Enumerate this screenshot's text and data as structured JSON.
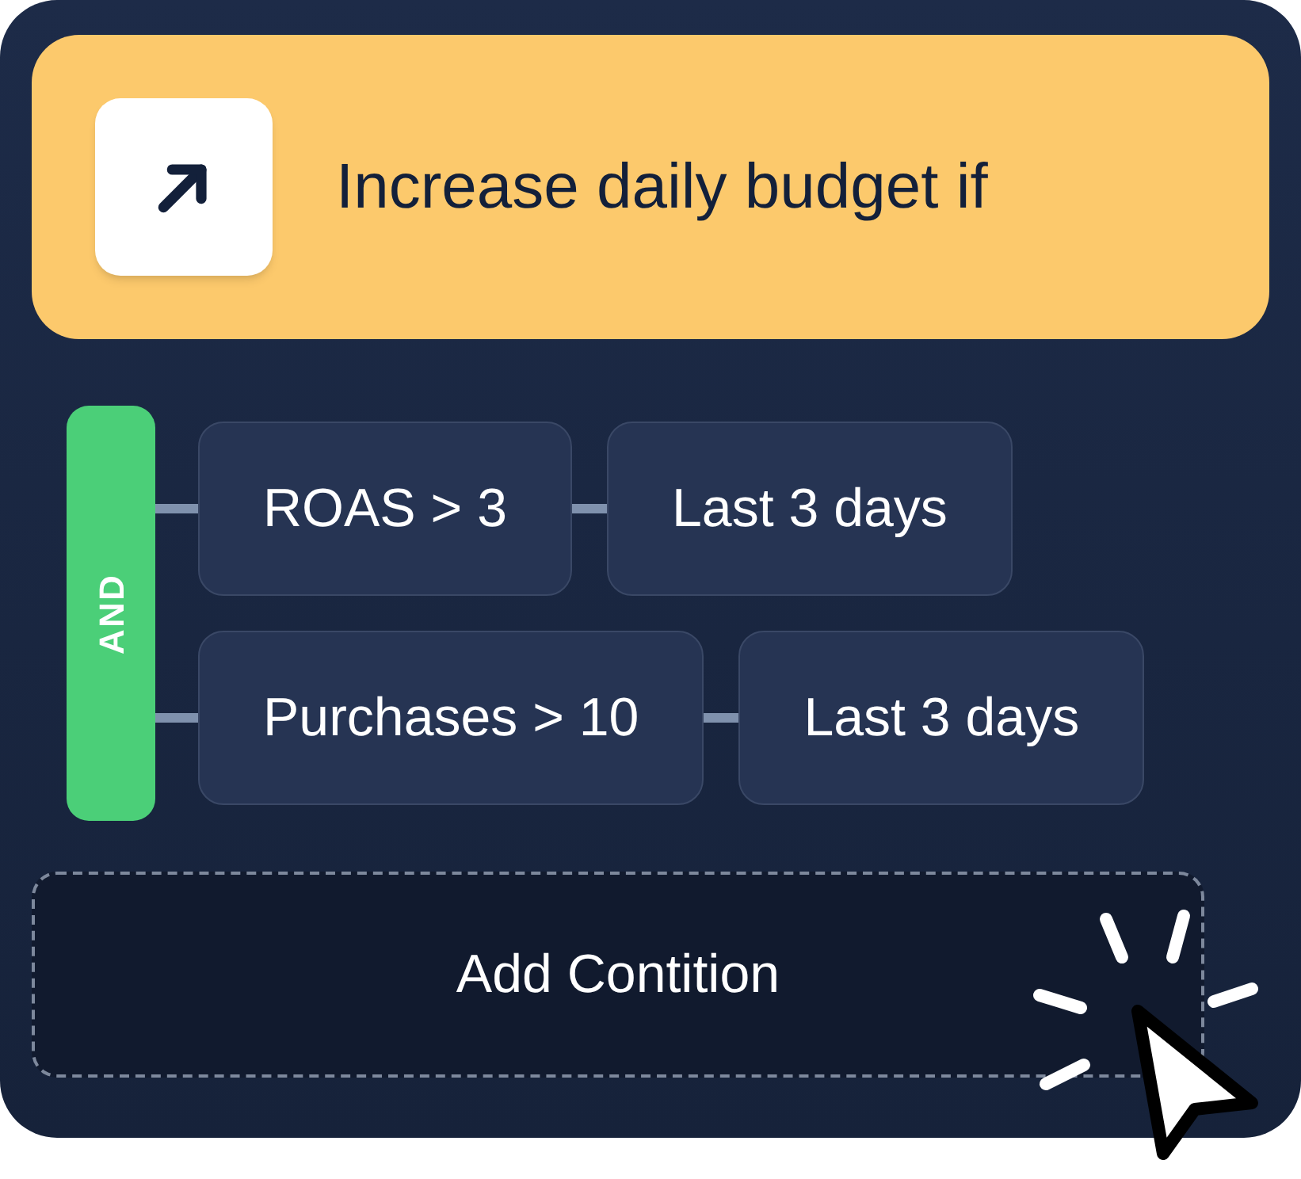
{
  "header": {
    "title": "Increase daily budget if"
  },
  "logic": {
    "operator": "AND"
  },
  "conditions": [
    {
      "metric": "ROAS > 3",
      "period": "Last 3 days"
    },
    {
      "metric": "Purchases > 10",
      "period": "Last 3 days"
    }
  ],
  "add_button": {
    "label": "Add Contition"
  }
}
